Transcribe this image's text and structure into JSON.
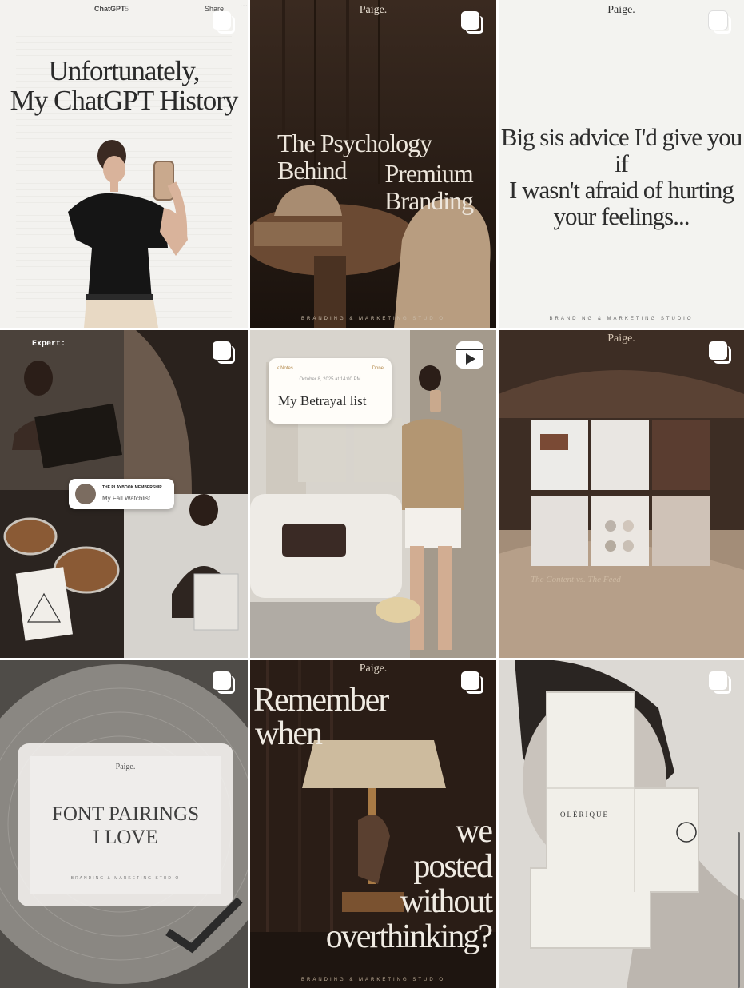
{
  "grid": {
    "tiles": [
      {
        "id": "chatgpt-history",
        "topbar": {
          "app": "ChatGPT",
          "version": "5",
          "share": "Share",
          "more": "···"
        },
        "headline_lines": [
          "Unfortunately,",
          "My ChatGPT History"
        ],
        "icon": "carousel-icon"
      },
      {
        "id": "psychology-branding",
        "wordmark": "Paige.",
        "headline_left": [
          "The Psychology",
          "Behind"
        ],
        "headline_right": [
          "Premium",
          "Branding"
        ],
        "footer": "BRANDING & MARKETING STUDIO",
        "icon": "carousel-icon"
      },
      {
        "id": "big-sis-advice",
        "wordmark": "Paige.",
        "headline_lines": [
          "Big sis advice I'd give you if",
          "I wasn't afraid of hurting",
          "your feelings..."
        ],
        "footer": "BRANDING & MARKETING STUDIO",
        "icon": "carousel-icon"
      },
      {
        "id": "playbook-membership",
        "expert": "Expert:",
        "card_label": "THE PLAYBOOK MEMBERSHIP",
        "card_text": "My Fall Watchlist",
        "icon": "carousel-icon"
      },
      {
        "id": "betrayal-list",
        "note": {
          "back": "< Notes",
          "done": "Done",
          "date": "October 8, 2025 at 14:00 PM",
          "title": "My Betrayal list"
        },
        "icon": "reel-icon"
      },
      {
        "id": "content-vs-feed",
        "wordmark": "Paige.",
        "caption": "The Content vs. The Feed",
        "icon": "carousel-icon"
      },
      {
        "id": "font-pairings",
        "card": {
          "logo": "Paige.",
          "title_lines": [
            "FONT PAIRINGS",
            "I LOVE"
          ],
          "studio": "BRANDING & MARKETING STUDIO"
        },
        "icon": "carousel-icon"
      },
      {
        "id": "remember-when",
        "wordmark": "Paige.",
        "line1": "Remember",
        "line2": "when",
        "rest_lines": [
          "we",
          "posted",
          "without",
          "overthinking?"
        ],
        "footer": "BRANDING & MARKETING STUDIO",
        "icon": "carousel-icon"
      },
      {
        "id": "olerique-packaging",
        "brand": "OLÉRIQUE",
        "icon": "carousel-icon"
      }
    ]
  },
  "colors": {
    "cream": "#ede6dc",
    "dark_brown": "#2a1f19",
    "offwhite": "#f3f3f0"
  }
}
